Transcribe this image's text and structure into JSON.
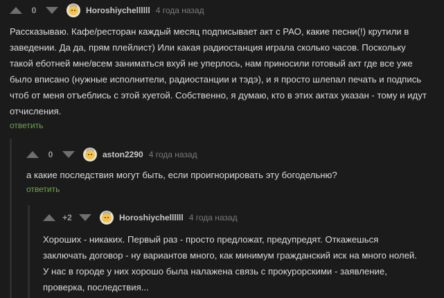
{
  "comments": [
    {
      "rating": "0",
      "username": "Horoshiychellllll",
      "time": "4 года назад",
      "text": "Рассказываю. Кафе/ресторан каждый месяц подписывает акт с РАО, какие песни(!) крутили в заведении. Да да, прям плейлист) Или какая радиостанция играла сколько часов. Поскольку такой еботней мне/всем заниматься вхуй не уперлось, нам приносили готовый акт где все уже было вписано (нужные исполнители, радиостанции и тэдэ), и я просто шлепал печать и подпись чтоб от меня отъеблись с этой хуетой. Собственно, я думаю, кто в этих актах указан - тому и идут отчисления.",
      "reply": "ответить"
    },
    {
      "rating": "0",
      "username": "aston2290",
      "time": "4 года назад",
      "text": "а какие последствия могут быть, если проигнорировать эту богодельню?",
      "reply": "ответить"
    },
    {
      "rating": "+2",
      "username": "Horoshiychellllll",
      "time": "4 года назад",
      "text": "Хороших - никаких. Первый раз - просто предложат, предупредят. Откажешься заключать договор - ну вариантов много, как минимум гражданский иск на много нолей. У нас в городе у них хорошо была налажена связь с прокурорскими - заявление, проверка, последствия..."
    }
  ]
}
